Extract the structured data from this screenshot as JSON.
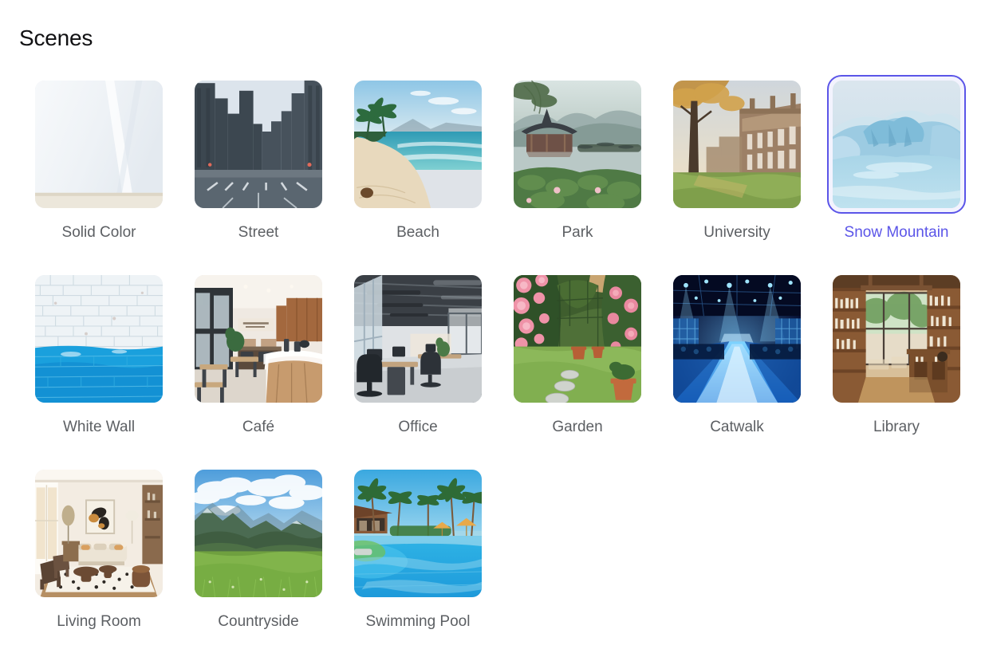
{
  "header": {
    "title": "Scenes"
  },
  "theme": {
    "accent": "#5b55e8",
    "label_color": "#5c5f63",
    "title_color": "#111113",
    "background": "#ffffff"
  },
  "scenes": [
    {
      "id": "solid-color",
      "label": "Solid Color",
      "selected": false,
      "art": "solid-color"
    },
    {
      "id": "street",
      "label": "Street",
      "selected": false,
      "art": "street"
    },
    {
      "id": "beach",
      "label": "Beach",
      "selected": false,
      "art": "beach"
    },
    {
      "id": "park",
      "label": "Park",
      "selected": false,
      "art": "park"
    },
    {
      "id": "university",
      "label": "University",
      "selected": false,
      "art": "university"
    },
    {
      "id": "snow-mountain",
      "label": "Snow Mountain",
      "selected": true,
      "art": "snow-mountain"
    },
    {
      "id": "white-wall",
      "label": "White Wall",
      "selected": false,
      "art": "white-wall"
    },
    {
      "id": "cafe",
      "label": "Café",
      "selected": false,
      "art": "cafe"
    },
    {
      "id": "office",
      "label": "Office",
      "selected": false,
      "art": "office"
    },
    {
      "id": "garden",
      "label": "Garden",
      "selected": false,
      "art": "garden"
    },
    {
      "id": "catwalk",
      "label": "Catwalk",
      "selected": false,
      "art": "catwalk"
    },
    {
      "id": "library",
      "label": "Library",
      "selected": false,
      "art": "library"
    },
    {
      "id": "living-room",
      "label": "Living Room",
      "selected": false,
      "art": "living-room"
    },
    {
      "id": "countryside",
      "label": "Countryside",
      "selected": false,
      "art": "countryside"
    },
    {
      "id": "swimming-pool",
      "label": "Swimming Pool",
      "selected": false,
      "art": "swimming-pool"
    }
  ]
}
